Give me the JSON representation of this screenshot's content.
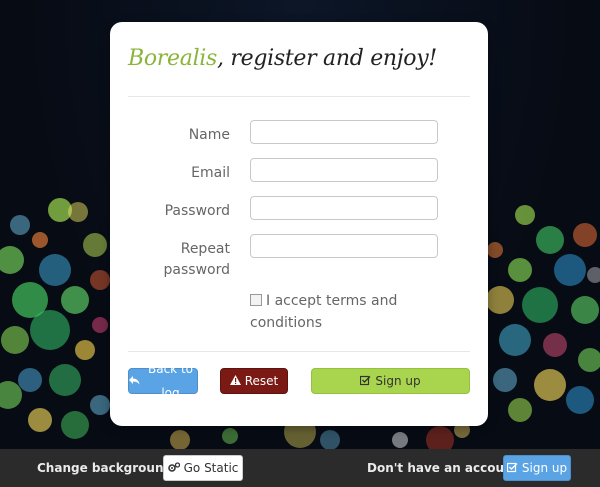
{
  "form": {
    "brand": "Borealis",
    "title_rest": ", register and enjoy!",
    "fields": [
      {
        "label": "Name",
        "value": "",
        "placeholder": ""
      },
      {
        "label": "Email",
        "value": "",
        "placeholder": ""
      },
      {
        "label": "Password",
        "value": "",
        "placeholder": ""
      },
      {
        "label_line1": "Repeat",
        "label_line2": "password",
        "value": "",
        "placeholder": ""
      }
    ],
    "terms_label_line1": "I accept terms and",
    "terms_label_line2": "conditions",
    "terms_checked": false
  },
  "buttons": {
    "back": "Back to log",
    "reset": "Reset",
    "signup": "Sign up"
  },
  "footer": {
    "change_bg_text": "Change background?",
    "go_static": "Go Static",
    "no_account_text": "Don't have an account?",
    "signup": "Sign up"
  },
  "colors": {
    "brand": "#8ab53a",
    "primary": "#5aa4e6",
    "danger": "#7b1a14",
    "success": "#a9d54e",
    "footer_bg": "#2b2b2b"
  },
  "icons": {
    "back": "reply-icon",
    "reset": "warning-icon",
    "signup": "checkbox-icon",
    "go_static": "gears-icon",
    "footer_signup": "checkbox-icon"
  }
}
